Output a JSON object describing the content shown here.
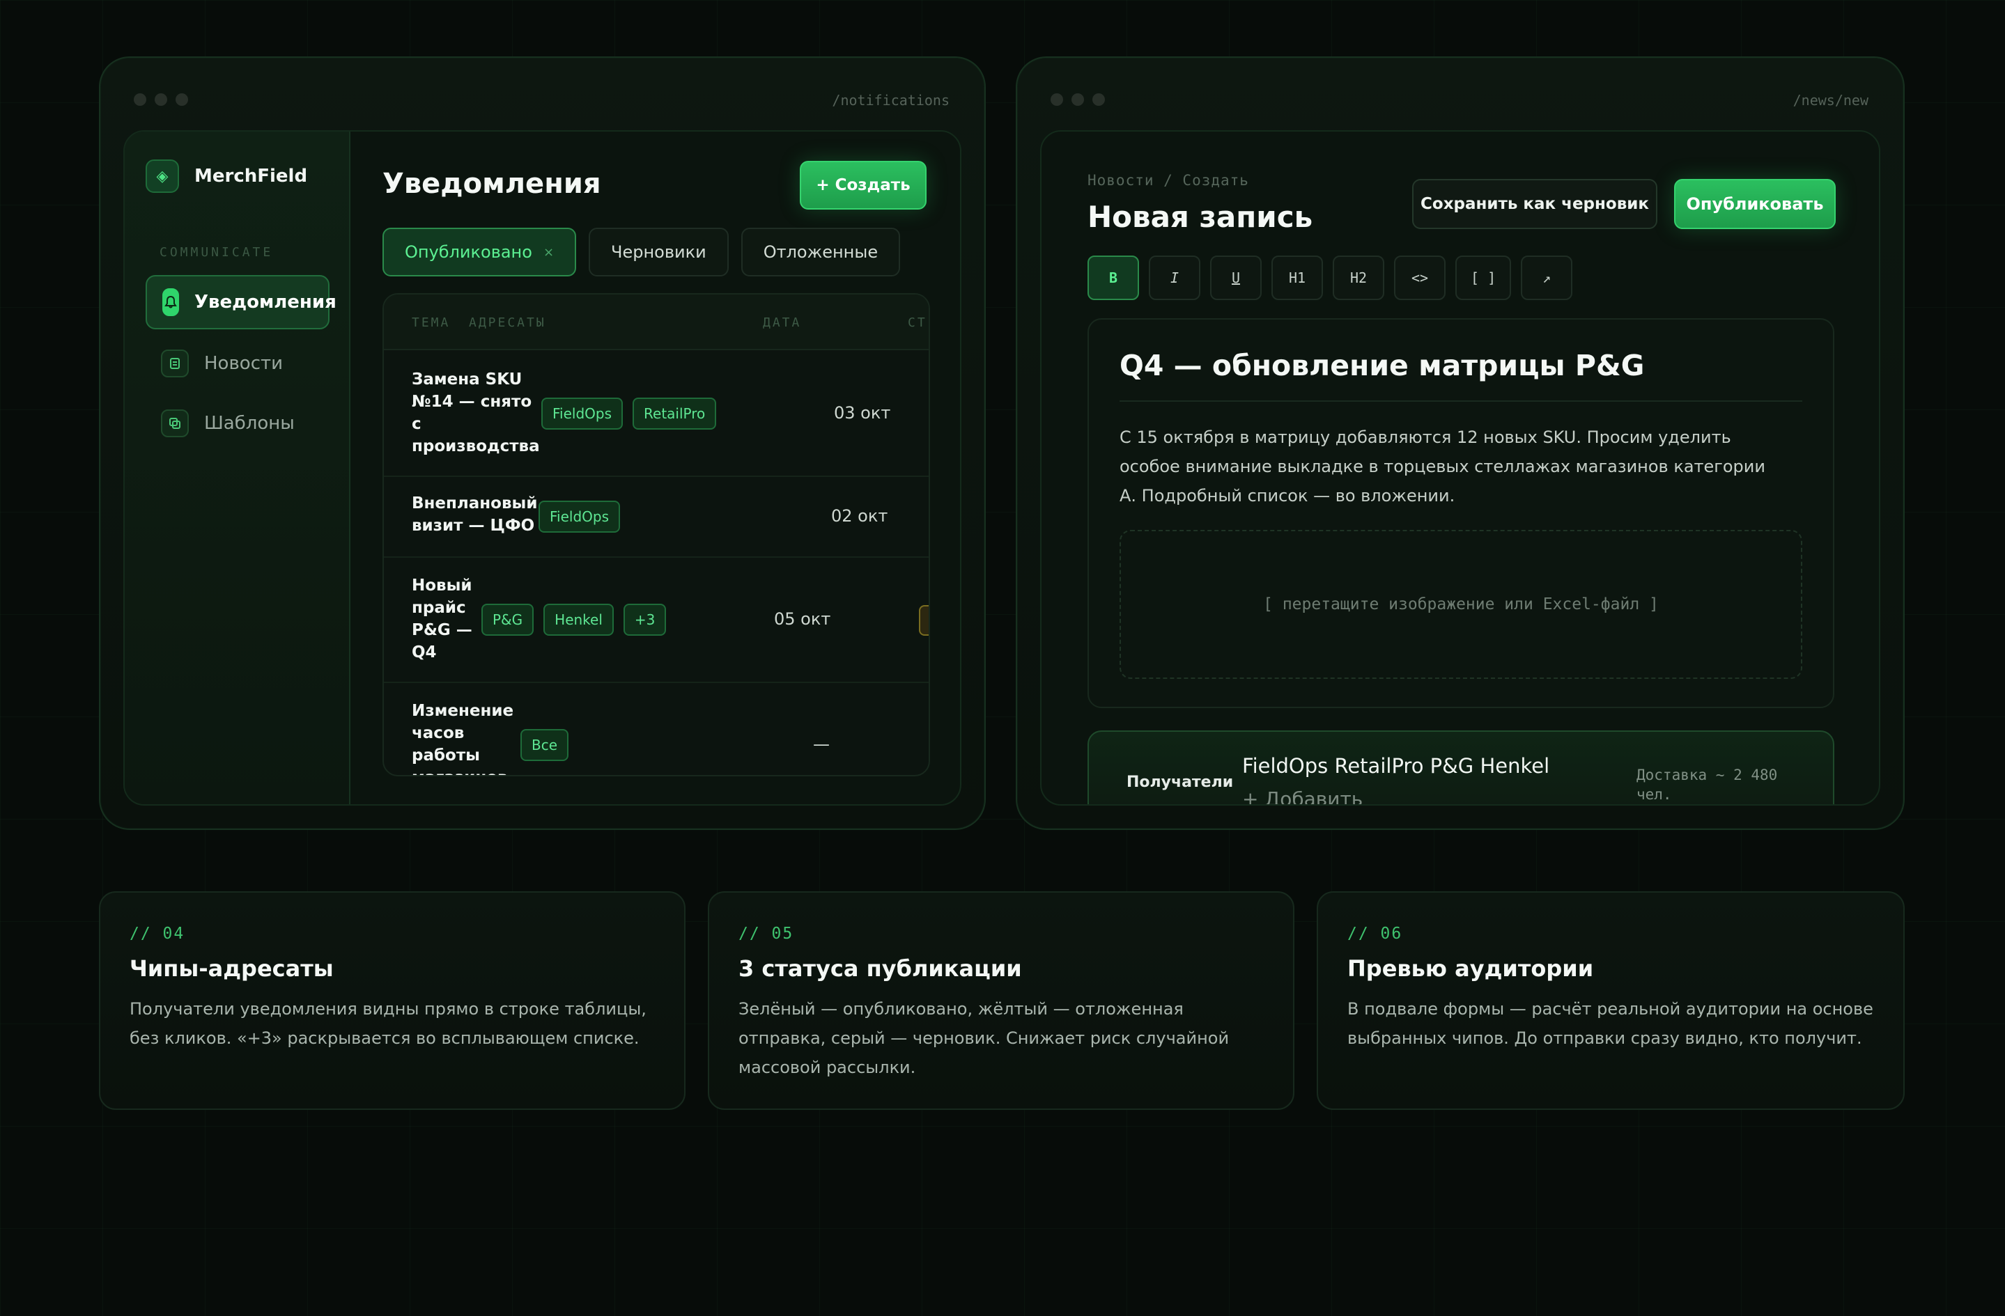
{
  "left_window": {
    "path": "/notifications",
    "brand": "MerchField",
    "section_label": "COMMUNICATE",
    "nav": [
      {
        "label": "Уведомления"
      },
      {
        "label": "Новости"
      },
      {
        "label": "Шаблоны"
      }
    ],
    "title": "Уведомления",
    "create_button": "+ Создать",
    "filters": [
      {
        "label": "Опубликовано",
        "close": "×"
      },
      {
        "label": "Черновики"
      },
      {
        "label": "Отложенные"
      }
    ],
    "table": {
      "headers": {
        "topic": "ТЕМА",
        "recipients": "АДРЕСАТЫ",
        "date": "ДАТА",
        "status": "СТ"
      },
      "rows": [
        {
          "topic_lines": [
            "Замена SKU",
            "№14 — снято",
            "с",
            "производства"
          ],
          "chips": [
            "FieldOps",
            "RetailPro"
          ],
          "date": "03 окт"
        },
        {
          "topic_lines": [
            "Внеплановый",
            "визит — ЦФО"
          ],
          "chips": [
            "FieldOps"
          ],
          "date": "02 окт"
        },
        {
          "topic_lines": [
            "Новый",
            "прайс",
            "P&G —",
            "Q4"
          ],
          "chips": [
            "P&G",
            "Henkel",
            "+3"
          ],
          "date": "05 окт"
        },
        {
          "topic_lines": [
            "Изменение",
            "часов",
            "работы",
            "магазинов"
          ],
          "chips": [
            "Все"
          ],
          "date": "—"
        }
      ]
    }
  },
  "right_window": {
    "path": "/news/new",
    "breadcrumb": "Новости / Создать",
    "title": "Новая запись",
    "draft_button": "Сохранить как черновик",
    "publish_button": "Опубликовать",
    "toolbar": [
      "B",
      "I",
      "U",
      "H1",
      "H2",
      "<>",
      "[ ]",
      "↗"
    ],
    "doc_title": "Q4 — обновление матрицы P&G",
    "doc_body": "С 15 октября в матрицу добавляются 12 новых SKU. Просим уделить особое внимание выкладке в торцевых стеллажах магазинов категории А. Подробный список — во вложении.",
    "dropzone": "[ перетащите изображение или Excel-файл ]",
    "recipients_label": "Получатели",
    "recipients_chips": "FieldOps RetailPro P&G Henkel",
    "recipients_add": "+ Добавить",
    "delivery": "Доставка ~ 2 480 чел."
  },
  "cards": [
    {
      "num": "// 04",
      "title": "Чипы-адресаты",
      "text": "Получатели уведомления видны прямо в строке таблицы, без кликов. «+3» раскрывается во всплывающем списке."
    },
    {
      "num": "// 05",
      "title": "3 статуса публикации",
      "text": "Зелёный — опубликовано, жёлтый — отложенная отправка, серый — черновик. Снижает риск случайной массовой рассылки."
    },
    {
      "num": "// 06",
      "title": "Превью аудитории",
      "text": "В подвале формы — расчёт реальной аудитории на основе выбранных чипов. До отправки сразу видно, кто получит."
    }
  ],
  "colors": {
    "accent": "#2fd56b",
    "background": "#070c09",
    "warning": "#7a6d20"
  }
}
